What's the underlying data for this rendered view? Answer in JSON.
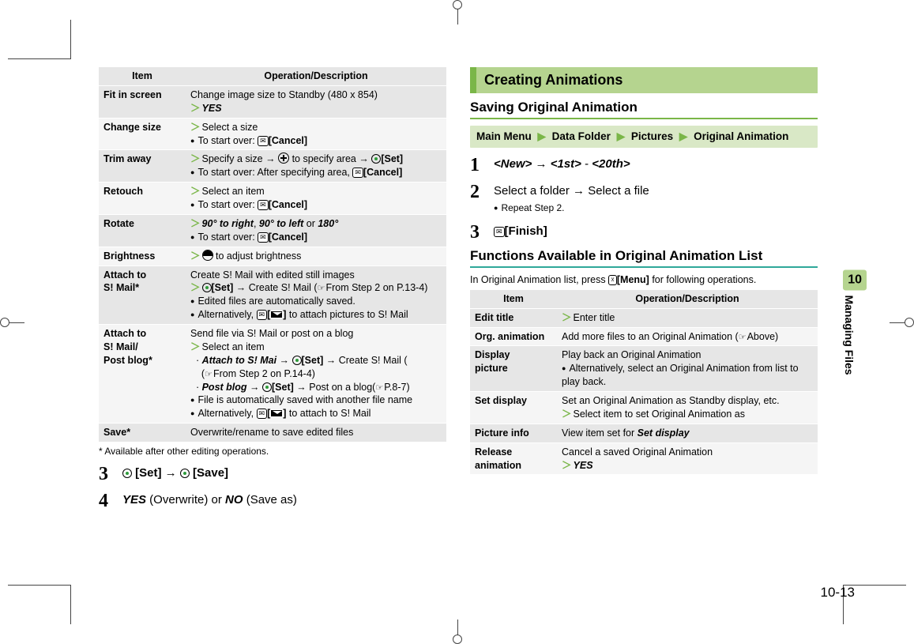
{
  "col_left": {
    "table_head": {
      "item": "Item",
      "op": "Operation/Description"
    },
    "rows": [
      {
        "item": "Fit in screen",
        "desc": "Change image size to Standby (480 x 854)",
        "extra": "YES"
      },
      {
        "item": "Change size",
        "line1": "Select a size",
        "bullet": "[Cancel]",
        "prefix": "To start over: "
      },
      {
        "item": "Trim away",
        "line1": "Specify a size → ",
        "tail": " to specify area → ",
        "set": "[Set]",
        "bullet": "[Cancel]",
        "prefix": "To start over: After specifying area, "
      },
      {
        "item": "Retouch",
        "line1": "Select an item",
        "prefix": "To start over: ",
        "bullet": "[Cancel]"
      },
      {
        "item": "Rotate",
        "opts": "90° to right, 90° to left or 180°",
        "prefix": "To start over: ",
        "bullet": "[Cancel]"
      },
      {
        "item": "Brightness",
        "line1": " to adjust brightness"
      },
      {
        "item": "Attach to S! Mail*",
        "desc": "Create S! Mail with edited still images",
        "set": "[Set]",
        "create": " → Create S! Mail (",
        "ref": "From Step 2 on P.13-4)",
        "b1": "Edited files are automatically saved.",
        "b2": "Alternatively, ",
        "b2tail": " to attach pictures to S! Mail"
      },
      {
        "item": "Attach to S! Mail/ Post blog*",
        "desc": "Send file via S! Mail or post on a blog",
        "line1": "Select an item",
        "o1a": "Attach to S! Mai",
        "o1b": "[Set]",
        "o1c": " → Create S! Mail (",
        "o1ref": "From Step 2 on P.14-4)",
        "o2a": "Post blog",
        "o2b": "[Set]",
        "o2c": " → Post on a blog(",
        "o2ref": "P.8-7)",
        "b1": "File is automatically saved with another file name",
        "b2": "Alternatively, ",
        "b2tail": " to attach to S! Mail"
      },
      {
        "item": "Save*",
        "desc": "Overwrite/rename to save edited files"
      }
    ],
    "footnote": "* Available after other editing operations.",
    "step3": {
      "set": "[Set]",
      "save": "[Save]"
    },
    "step4": {
      "yes": "YES",
      "overwrite": " (Overwrite) or ",
      "no": "NO",
      "saveas": " (Save as)"
    }
  },
  "col_right": {
    "heading": "Creating Animations",
    "sub1": "Saving Original Animation",
    "menu": {
      "root": "Main Menu",
      "s1": "Data Folder",
      "s2": "Pictures",
      "s3": "Original Animation"
    },
    "step1": {
      "new": "<New>",
      "range": "<1st> - <20th>"
    },
    "step2": {
      "a": "Select a folder → Select a file",
      "b": "Repeat Step 2."
    },
    "step3": "[Finish]",
    "sub2": "Functions Available in Original Animation List",
    "lead": "In Original Animation list, press ",
    "menu_label": "[Menu]",
    "lead_tail": " for following operations.",
    "table_head": {
      "item": "Item",
      "op": "Operation/Description"
    },
    "rows": [
      {
        "item": "Edit title",
        "g": "Enter title"
      },
      {
        "item": "Org. animation",
        "desc": "Add more files to an Original Animation (",
        "ref": "Above)"
      },
      {
        "item": "Display picture",
        "desc": "Play back an Original Animation",
        "bullet": "Alternatively, select an Original Animation from list to play back."
      },
      {
        "item": "Set display",
        "desc": "Set an Original Animation as Standby display, etc.",
        "g": "Select item to set Original Animation as"
      },
      {
        "item": "Picture info",
        "desc": "View item set for ",
        "ital": "Set display"
      },
      {
        "item": "Release animation",
        "desc": "Cancel a saved Original Animation",
        "g": "YES"
      }
    ]
  },
  "side": {
    "chip": "10",
    "label": "Managing Files"
  },
  "pagenum": "10-13"
}
